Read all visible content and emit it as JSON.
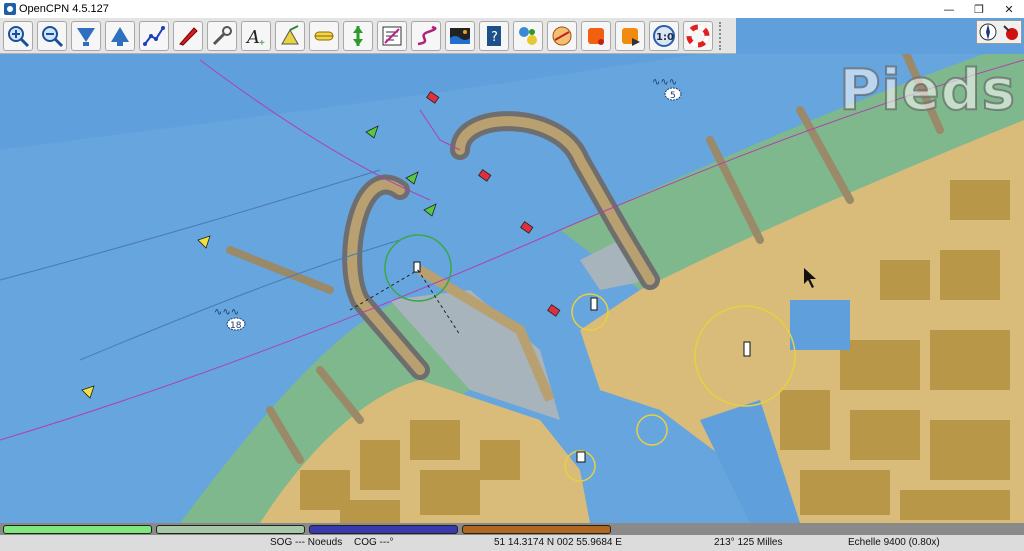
{
  "window": {
    "title": "OpenCPN 4.5.127",
    "min_glyph": "—",
    "max_glyph": "❐",
    "close_glyph": "✕"
  },
  "toolbar": {
    "buttons": [
      {
        "name": "zoom-in-icon"
      },
      {
        "name": "zoom-out-icon"
      },
      {
        "name": "scale-down-icon"
      },
      {
        "name": "scale-up-icon"
      },
      {
        "name": "route-icon"
      },
      {
        "name": "ownship-follow-icon"
      },
      {
        "name": "settings-wrench-icon"
      },
      {
        "name": "text-toggle-icon"
      },
      {
        "name": "light-icon"
      },
      {
        "name": "ais-icon"
      },
      {
        "name": "current-icon"
      },
      {
        "name": "route-manager-icon"
      },
      {
        "name": "track-icon"
      },
      {
        "name": "tide-icon"
      },
      {
        "name": "help-book-icon"
      },
      {
        "name": "plugin-icon"
      },
      {
        "name": "grib-icon"
      },
      {
        "name": "record-icon"
      },
      {
        "name": "print-icon"
      },
      {
        "name": "gauge-icon"
      },
      {
        "name": "mob-lifebuoy-icon"
      }
    ]
  },
  "chart": {
    "units_label": "Pieds",
    "soundings": [
      {
        "label": "5"
      },
      {
        "label": "18"
      }
    ],
    "colors": {
      "water": "#5fa0dc",
      "land": "#d9bc7a",
      "built": "#b89848",
      "intertidal": "#7fb88c",
      "drying": "#a8b4bc"
    }
  },
  "piano": {
    "keys": [
      {
        "color": "#7ee87e"
      },
      {
        "color": "#a6c8a6"
      },
      {
        "color": "#3a3ab0"
      },
      {
        "color": "#b06820"
      }
    ]
  },
  "status": {
    "sog": "SOG --- Noeuds",
    "cog": "COG ---°",
    "position": "51 14.3174 N    002 55.9684 E",
    "bearing": "213°  125 Milles",
    "scale": "Echelle 9400 (0.80x)"
  }
}
